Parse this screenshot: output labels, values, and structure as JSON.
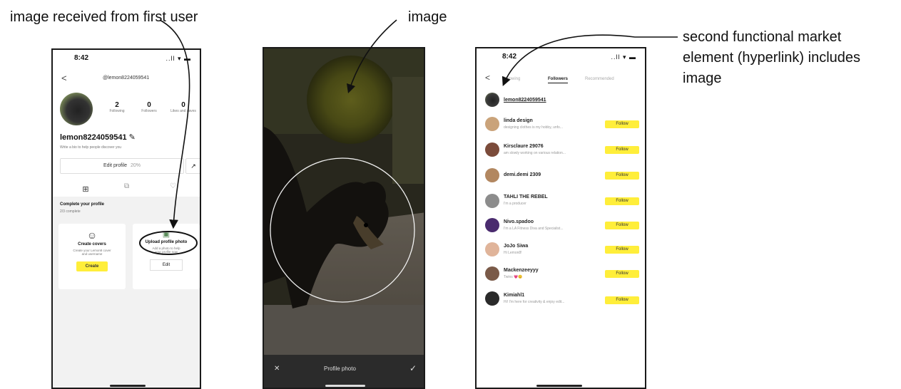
{
  "callouts": {
    "left": "image received from first user",
    "middle": "image",
    "right_line1": "second functional market",
    "right_line2": "element (hyperlink) includes",
    "right_line3": "image"
  },
  "phone1": {
    "time": "8:42",
    "signal": "..ll ▾ ▬",
    "back": "<",
    "handle": "@lemon8224059541",
    "stats": [
      {
        "num": "2",
        "label": "Following"
      },
      {
        "num": "0",
        "label": "Followers"
      },
      {
        "num": "0",
        "label": "Likes and saves"
      }
    ],
    "username": "lemon8224059541",
    "bio": "Write a bio to help people discover you",
    "edit_profile": "Edit profile",
    "edit_badge": "20%",
    "complete_title": "Complete your profile",
    "complete_sub": "2/3 complete",
    "card1": {
      "title": "Create covers",
      "desc1": "Create your Lemon8 cover",
      "desc2": "and username",
      "btn": "Create"
    },
    "card2": {
      "title": "Upload profile photo",
      "desc1": "Add a photo to help",
      "desc2": "your profile now",
      "btn": "Edit"
    }
  },
  "phone2": {
    "close": "✕",
    "title": "Profile photo",
    "check": "✓"
  },
  "phone3": {
    "time": "8:42",
    "signal": "..ll ▾ ▬",
    "back": "<",
    "tabs": [
      "Following",
      "Followers",
      "Recommended"
    ],
    "top_user": "lemon8224059541",
    "rows": [
      {
        "name": "linda design",
        "sub": "designing clothes is my hobby, unfo...",
        "btn": "Follow",
        "color": "#caa37a"
      },
      {
        "name": "Kirsclaure 29076",
        "sub": "am slowly working on various relation...",
        "btn": "Follow",
        "color": "#7b4b3a"
      },
      {
        "name": "demi.demi 2309",
        "sub": "",
        "btn": "Follow",
        "color": "#b28760"
      },
      {
        "name": "TAHLI THE REBEL",
        "sub": "I'm a producer",
        "btn": "Follow",
        "color": "#8c8c8c"
      },
      {
        "name": "Nivo.spadoo",
        "sub": "I'm a LA Fitness Diva and Specialist...",
        "btn": "Follow",
        "color": "#4a2b6e"
      },
      {
        "name": "JoJo Siwa",
        "sub": "Hi Lemon8!",
        "btn": "Follow",
        "color": "#e0b49a"
      },
      {
        "name": "Mackenzeeyyy",
        "sub": "Twins 💗😊",
        "btn": "Follow",
        "color": "#7a5a48"
      },
      {
        "name": "Kimiahl1",
        "sub": "Hi! I'm here for creativity & enjoy edit...",
        "btn": "Follow",
        "color": "#2a2a2a"
      }
    ]
  }
}
